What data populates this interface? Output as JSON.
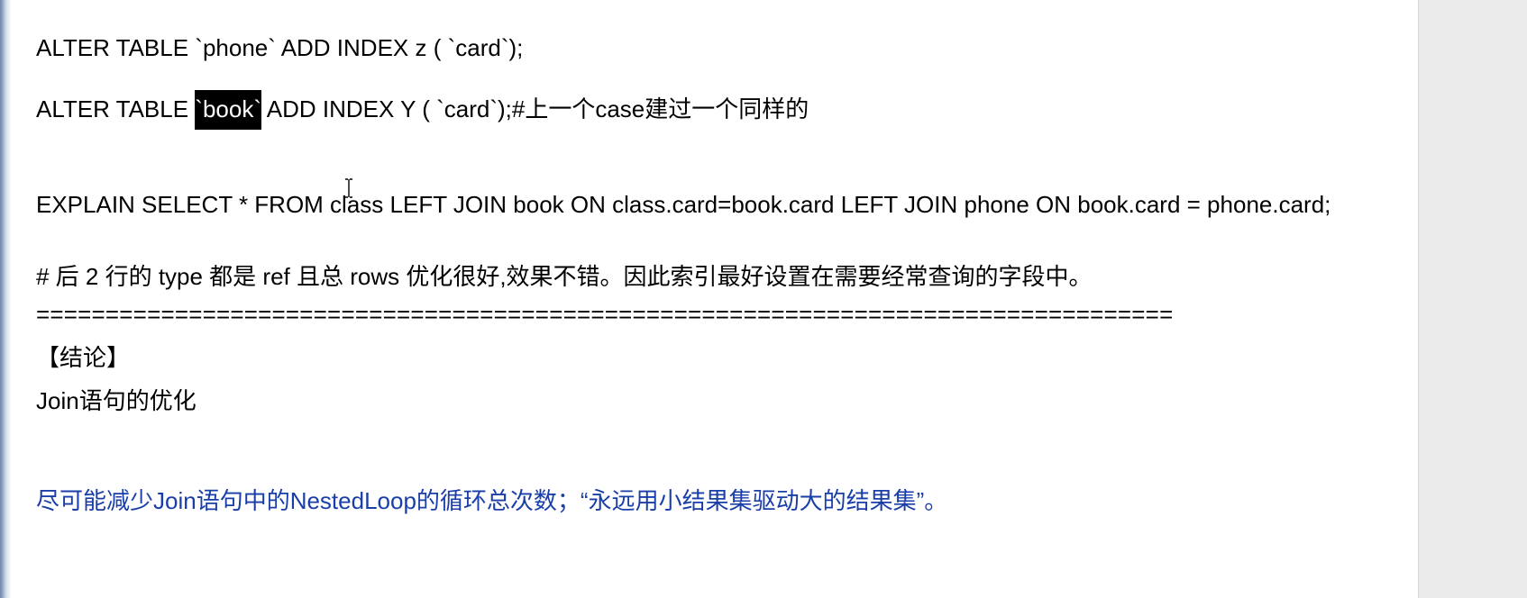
{
  "document": {
    "line1": "ALTER TABLE `phone` ADD INDEX z ( `card`);",
    "line2_pre": "ALTER TABLE ",
    "line2_selected": "`book`",
    "line2_post": " ADD INDEX Y ( `card`);#上一个case建过一个同样的",
    "line3": "EXPLAIN SELECT * FROM class LEFT JOIN book ON class.card=book.card LEFT JOIN phone ON book.card = phone.card;",
    "line4": "# 后 2 行的 type 都是 ref 且总 rows 优化很好,效果不错。因此索引最好设置在需要经常查询的字段中。",
    "separator": "==================================================================================",
    "conclusion_heading": "【结论】",
    "join_optimization": "Join语句的优化",
    "advice": "尽可能减少Join语句中的NestedLoop的循环总次数；“永远用小结果集驱动大的结果集”。"
  },
  "colors": {
    "text": "#000000",
    "advice_blue": "#1a3ea8",
    "selection_bg": "#000000",
    "selection_fg": "#ffffff"
  },
  "icons": {
    "cursor": "i-beam-cursor-icon"
  }
}
